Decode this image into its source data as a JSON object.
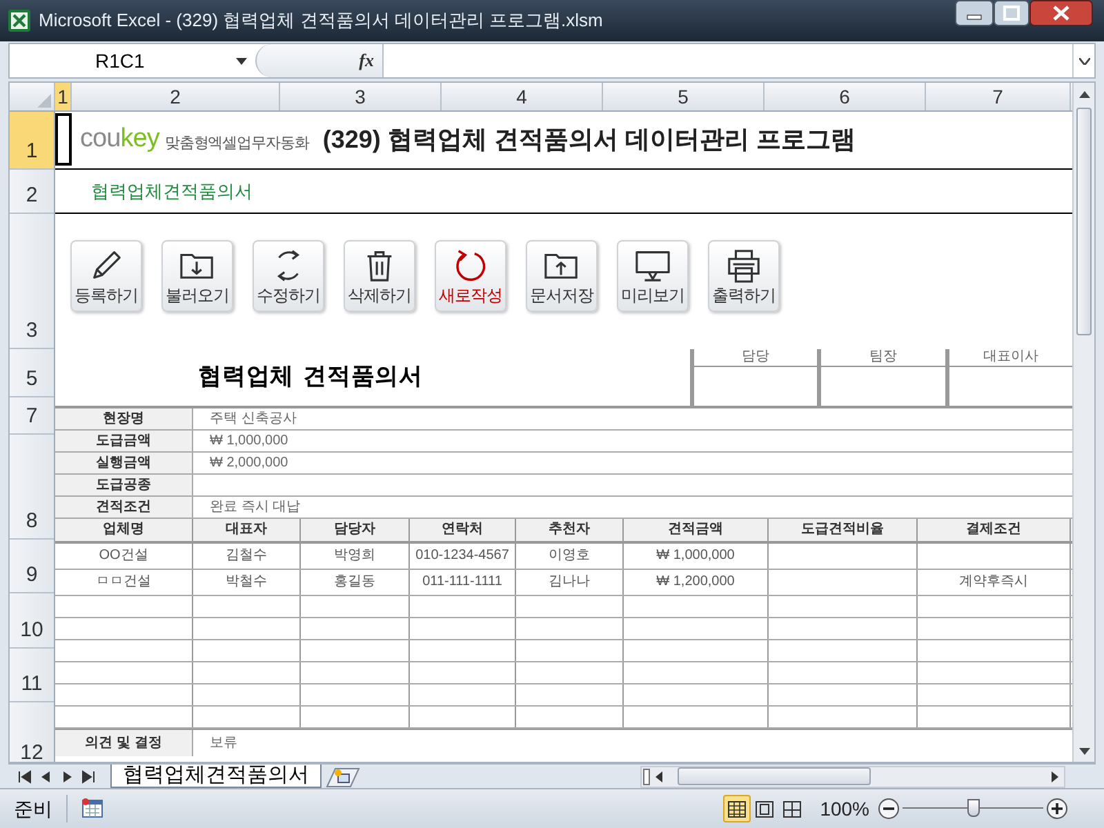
{
  "window": {
    "title": "Microsoft Excel - (329) 협력업체 견적품의서 데이터관리 프로그램.xlsm"
  },
  "formula_bar": {
    "name_box": "R1C1",
    "fx": "fx"
  },
  "column_headers": [
    {
      "label": "1",
      "selected": true
    },
    {
      "label": "2",
      "selected": false
    },
    {
      "label": "3",
      "selected": false
    },
    {
      "label": "4",
      "selected": false
    },
    {
      "label": "5",
      "selected": false
    },
    {
      "label": "6",
      "selected": false
    },
    {
      "label": "7",
      "selected": false
    }
  ],
  "row_headers": [
    {
      "label": "1",
      "selected": true
    },
    {
      "label": "2",
      "selected": false
    },
    {
      "label": "3",
      "selected": false
    },
    {
      "label": "5",
      "selected": false
    },
    {
      "label": "7",
      "selected": false
    },
    {
      "label": "8",
      "selected": false
    },
    {
      "label": "9",
      "selected": false
    },
    {
      "label": "10",
      "selected": false
    },
    {
      "label": "11",
      "selected": false
    },
    {
      "label": "12",
      "selected": false
    }
  ],
  "sheet": {
    "logo": {
      "part_1": "cou",
      "part_2": "key",
      "tagline": "맞춤형엑셀업무자동화"
    },
    "title": "(329) 협력업체 견적품의서 데이터관리 프로그램",
    "subtitle": "협력업체견적품의서",
    "buttons": [
      {
        "label": "등록하기",
        "kind": "pencil",
        "color": "#333333"
      },
      {
        "label": "불러오기",
        "kind": "folder_down",
        "color": "#333333"
      },
      {
        "label": "수정하기",
        "kind": "sync",
        "color": "#333333"
      },
      {
        "label": "삭제하기",
        "kind": "trash",
        "color": "#333333"
      },
      {
        "label": "새로작성",
        "kind": "new",
        "color": "#c00000"
      },
      {
        "label": "문서저장",
        "kind": "folder_up",
        "color": "#333333"
      },
      {
        "label": "미리보기",
        "kind": "monitor",
        "color": "#333333"
      },
      {
        "label": "출력하기",
        "kind": "printer",
        "color": "#333333"
      }
    ]
  },
  "form": {
    "title": "협력업체 견적품의서",
    "approvals": [
      "담당",
      "팀장",
      "대표이사"
    ],
    "info_rows": [
      {
        "label": "현장명",
        "value": "주택 신축공사"
      },
      {
        "label": "도급금액",
        "value": "₩ 1,000,000"
      },
      {
        "label": "실행금액",
        "value": "₩ 2,000,000"
      },
      {
        "label": "도급공종"
      },
      {
        "label": "견적조건",
        "value": "완료 즉시 대납"
      }
    ],
    "columns": [
      "업체명",
      "대표자",
      "담당자",
      "연락처",
      "추천자",
      "견적금액",
      "도급견적비율",
      "결제조건"
    ],
    "rows": [
      [
        "OO건설",
        "김철수",
        "박영희",
        "010-1234-4567",
        "이영호",
        "₩ 1,000,000",
        null,
        null
      ],
      [
        "ㅁㅁ건설",
        "박철수",
        "홍길동",
        "011-111-1111",
        "김나나",
        "₩ 1,200,000",
        null,
        "계약후즉시"
      ]
    ],
    "footer": {
      "label": "의견 및 결정",
      "value": "보류"
    }
  },
  "sheet_tabs": [
    {
      "label": "협력업체견적품의서",
      "selected": true
    }
  ],
  "status_bar": {
    "mode": "준비",
    "views": [
      {
        "kind": "normal",
        "selected": true
      },
      {
        "kind": "page_layout",
        "selected": false
      },
      {
        "kind": "page_break",
        "selected": false
      }
    ],
    "zoom": "100%",
    "zoom_slider": {
      "level": 0.5
    }
  }
}
